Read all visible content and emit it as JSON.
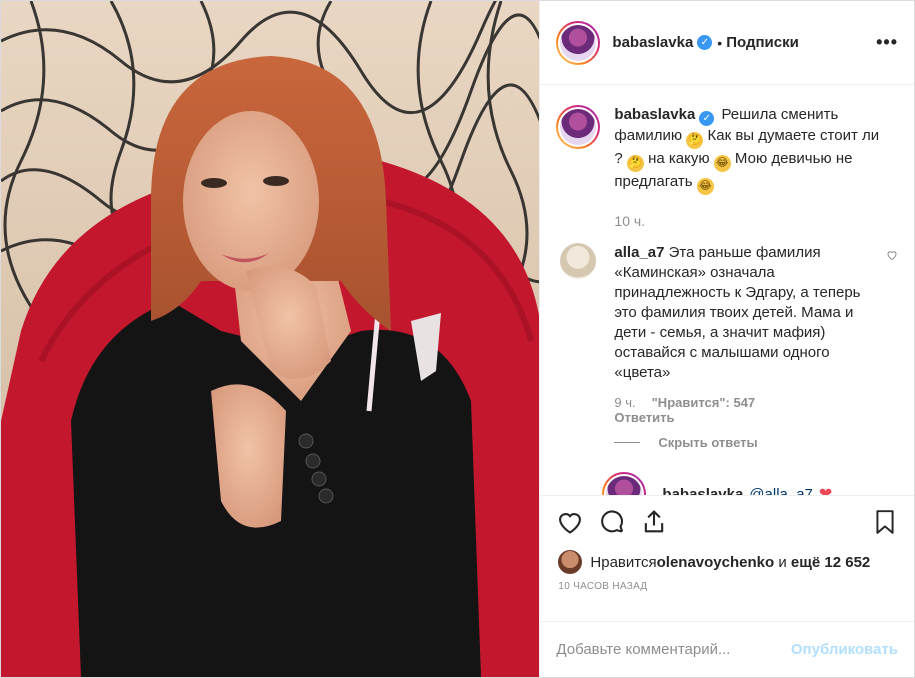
{
  "header": {
    "username": "babaslavka",
    "separator": "•",
    "follow_label": "Подписки",
    "more_label": "•••"
  },
  "caption": {
    "username": "babaslavka",
    "text_1": " Решила сменить фамилию ",
    "text_2": " Как вы думаете стоит ли ? ",
    "text_3": " на какую ",
    "text_4": " Мою девичью не предлагать ",
    "time": "10 ч."
  },
  "comment": {
    "username": "alla_a7",
    "text": " Эта раньше фамилия «Каминская» означала принадлежность к Эдгару, а теперь это фамилия твоих детей. Мама и дети - семья, а значит мафия) оставайся с малышами одного «цвета»",
    "time": "9 ч.",
    "likes_label": "\"Нравится\": 547",
    "reply_label": "Ответить",
    "hide_replies": "Скрыть ответы"
  },
  "reply": {
    "username": "babaslavka",
    "mention": "@alla_a7"
  },
  "likes": {
    "prefix": "Нравится ",
    "user": "olenavoychenko",
    "middle": " и ",
    "count": "ещё 12 652"
  },
  "timestamp": "10 ЧАСОВ НАЗАД",
  "add_comment": {
    "placeholder": "Добавьте комментарий...",
    "publish": "Опубликовать"
  },
  "colors": {
    "link_blue": "#3897f0",
    "publish_disabled": "#b2dffc",
    "heart_red": "#ed4956"
  },
  "icons": [
    "verified-icon",
    "heart-icon",
    "comment-icon",
    "share-icon",
    "bookmark-icon",
    "thinking-emoji-icon",
    "laugh-emoji-icon"
  ]
}
